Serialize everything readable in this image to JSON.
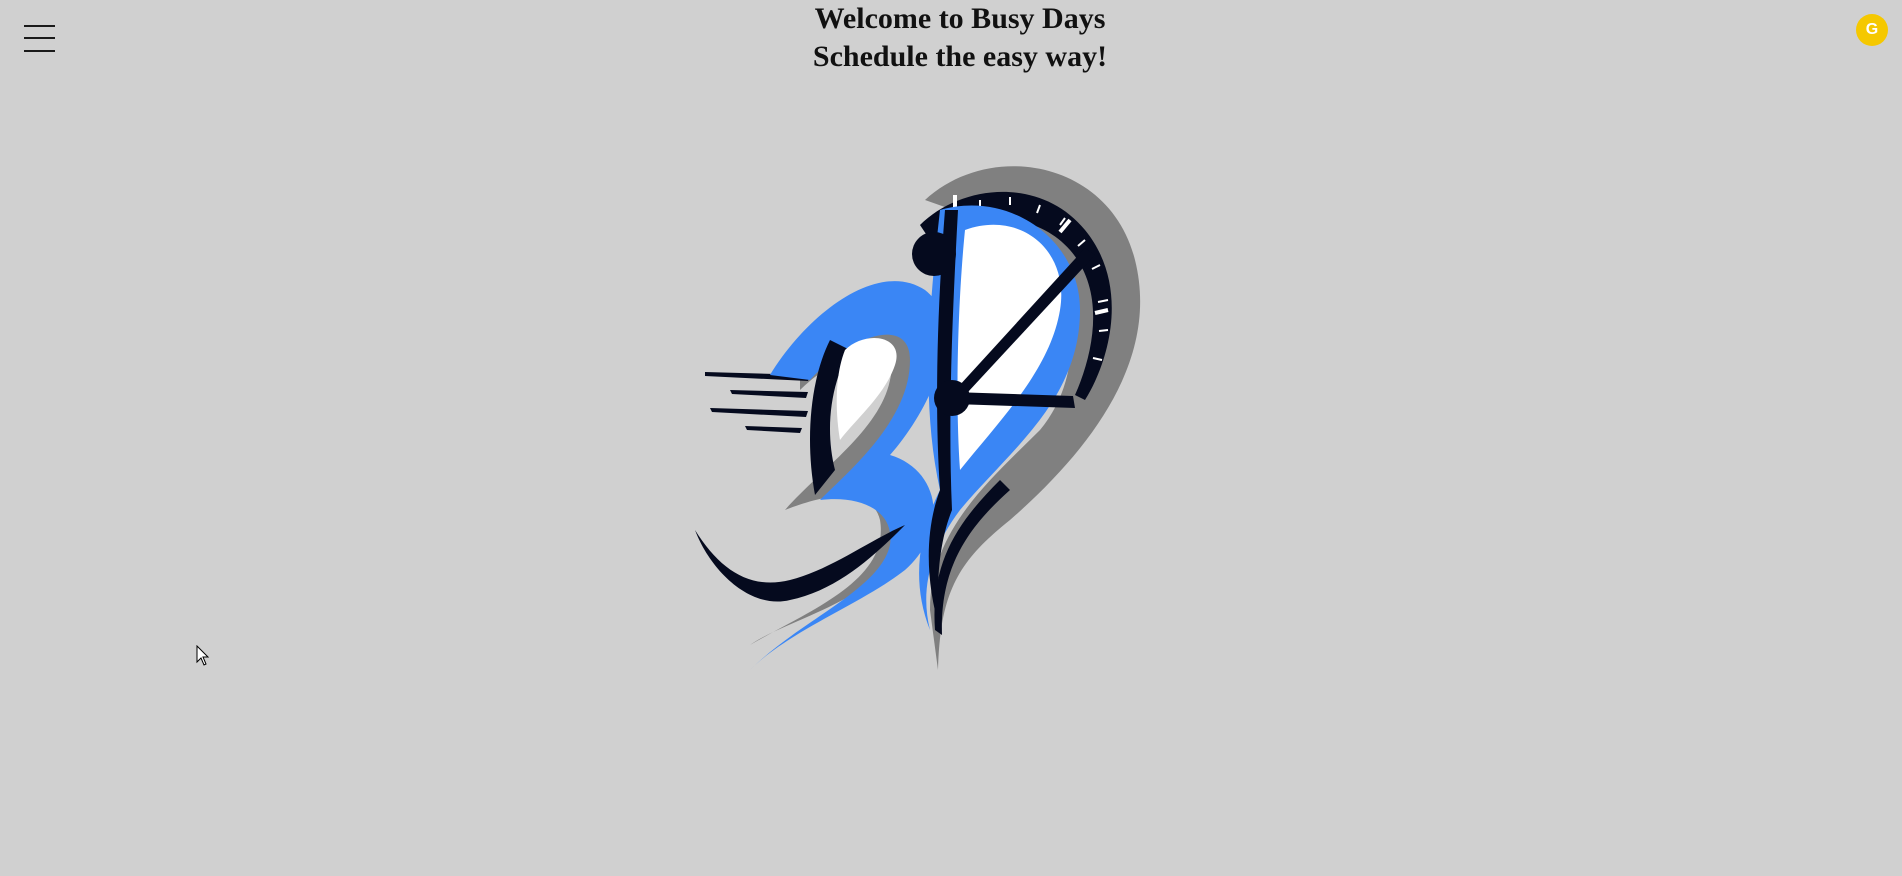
{
  "header": {
    "title_line1": "Welcome to Busy Days",
    "title_line2": "Schedule the easy way!"
  },
  "nav": {
    "menu_icon": "hamburger-menu-icon"
  },
  "user": {
    "avatar_initial": "G",
    "avatar_color": "#f5c800"
  },
  "logo": {
    "name": "busy-days-logo",
    "colors": {
      "blue": "#3a86f5",
      "dark": "#050a1e",
      "shadow": "#808080",
      "white": "#ffffff"
    }
  },
  "theme": {
    "background": "#d0d0d0",
    "text": "#111111"
  }
}
